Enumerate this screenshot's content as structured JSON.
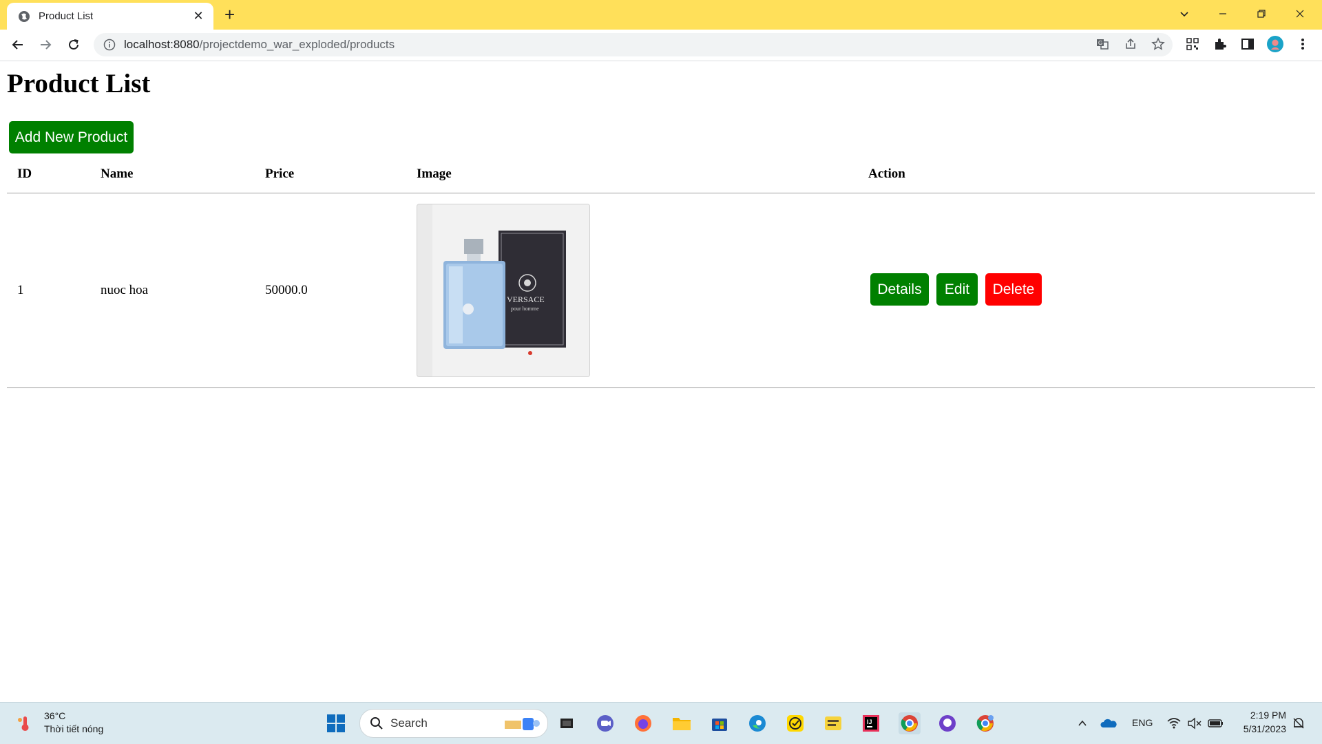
{
  "browser": {
    "tab_title": "Product List",
    "new_tab": "+",
    "url_host": "localhost:8080",
    "url_path": "/projectdemo_war_exploded/products"
  },
  "page": {
    "title": "Product List",
    "add_button": "Add New Product",
    "columns": [
      "ID",
      "Name",
      "Price",
      "Image",
      "Action"
    ],
    "rows": [
      {
        "id": "1",
        "name": "nuoc hoa",
        "price": "50000.0",
        "image_brand_text": "VERSACE",
        "image_sub_text": "pour homme",
        "actions": [
          "Details",
          "Edit",
          "Delete"
        ]
      }
    ]
  },
  "taskbar": {
    "weather_temp": "36°C",
    "weather_desc": "Thời tiết nóng",
    "search_label": "Search",
    "language": "ENG",
    "time": "2:19 PM",
    "date": "5/31/2023"
  },
  "colors": {
    "tabbar": "#ffe05a",
    "primary_button": "#008000",
    "danger_button": "#ff0000",
    "taskbar": "#dbeaf0"
  },
  "icons": [
    "globe-icon",
    "close-icon",
    "back-icon",
    "forward-icon",
    "reload-icon",
    "info-icon",
    "translate-icon",
    "share-icon",
    "star-icon",
    "qr-icon",
    "extensions-icon",
    "sidepanel-icon",
    "profile-avatar",
    "menu-icon",
    "windows-start-icon",
    "search-icon"
  ]
}
